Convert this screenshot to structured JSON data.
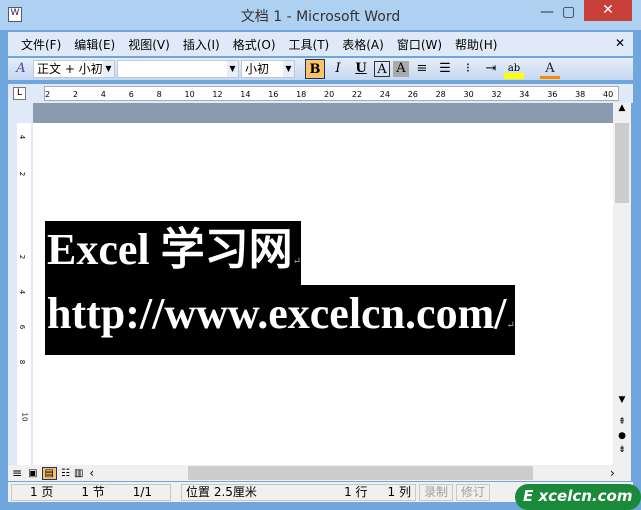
{
  "window": {
    "title": "文档 1 - Microsoft Word"
  },
  "menu": [
    "文件(F)",
    "编辑(E)",
    "视图(V)",
    "插入(I)",
    "格式(O)",
    "工具(T)",
    "表格(A)",
    "窗口(W)",
    "帮助(H)"
  ],
  "toolbar": {
    "style": "正文 + 小初",
    "font": "",
    "size": "小初",
    "bold": "B",
    "italic": "I",
    "underline": "U",
    "char_border": "A",
    "char_shading": "A",
    "font_color": "A",
    "highlight": "ab"
  },
  "ruler": {
    "h": [
      "2",
      "2",
      "4",
      "6",
      "8",
      "10",
      "12",
      "14",
      "16",
      "18",
      "20",
      "22",
      "24",
      "26",
      "28",
      "30",
      "32",
      "34",
      "36",
      "38",
      "40"
    ],
    "v": [
      "4",
      "2",
      "2",
      "4",
      "6",
      "8",
      "10"
    ]
  },
  "document": {
    "lines": [
      "Excel 学习网",
      "http://www.excelcn.com/"
    ],
    "paragraph_mark": "↵"
  },
  "status": {
    "page": "1 页",
    "section": "1 节",
    "pages": "1/1",
    "position": "位置 2.5厘米",
    "line": "1 行",
    "col": "1 列",
    "rec": "录制",
    "trk": "修订"
  },
  "watermark": "Excelcn.com"
}
